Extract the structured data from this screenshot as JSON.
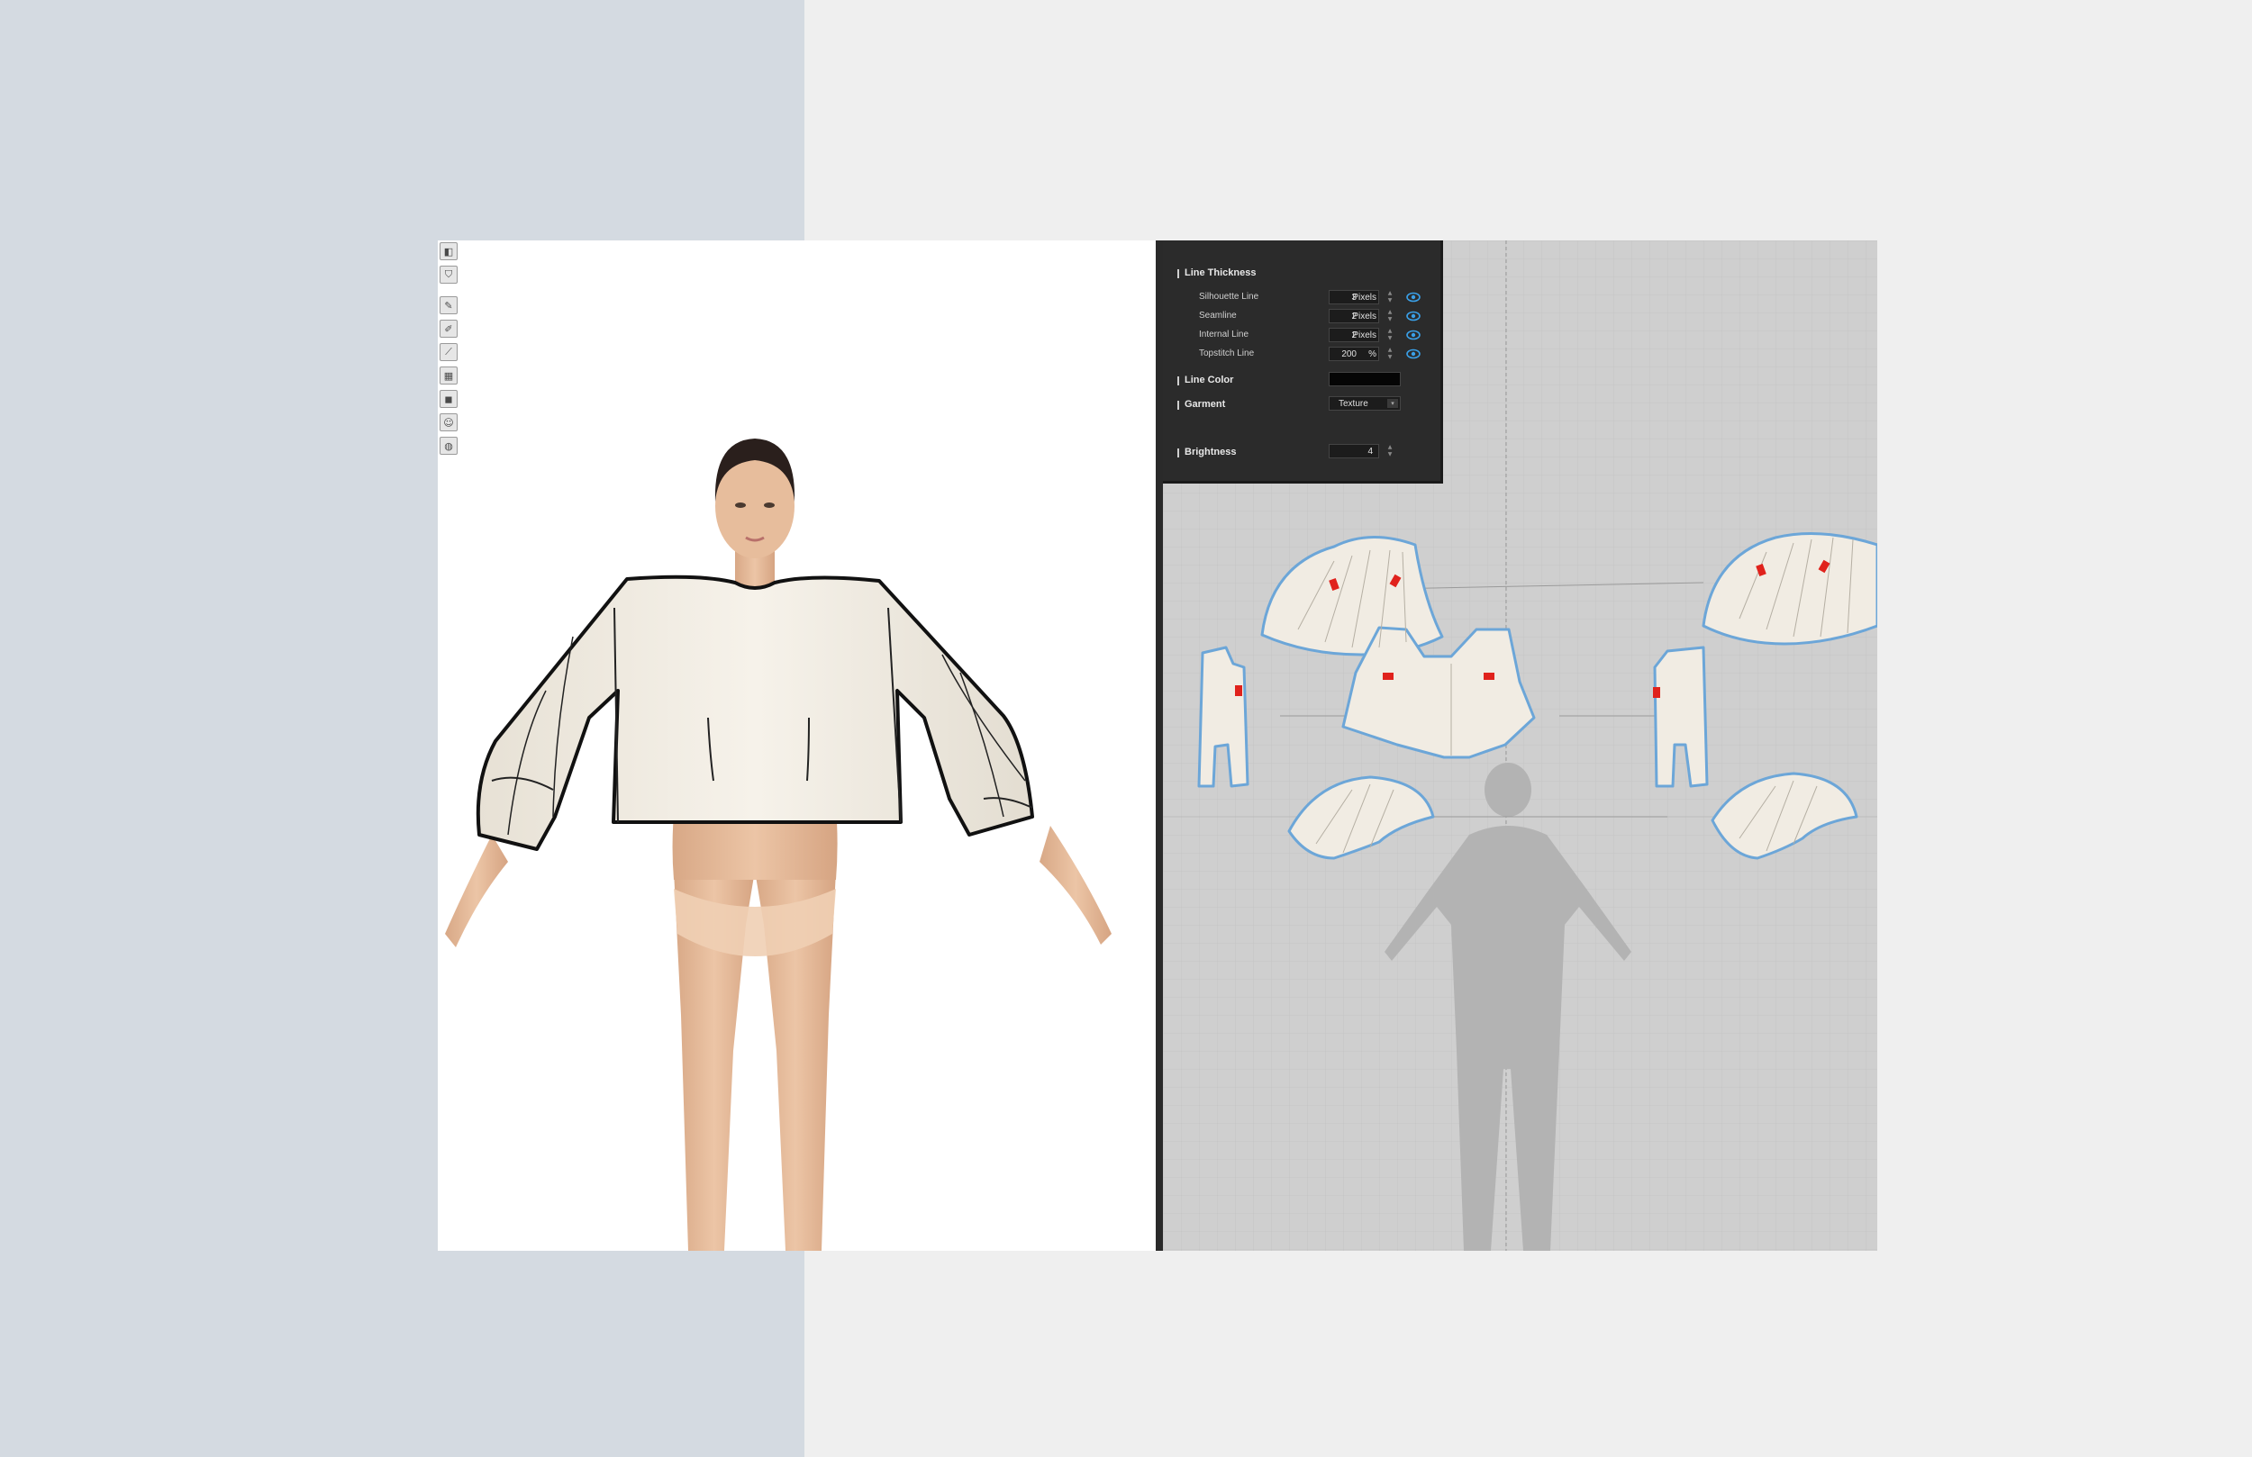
{
  "panel": {
    "line_thickness": {
      "title": "Line Thickness",
      "rows": [
        {
          "label": "Silhouette Line",
          "value": "3",
          "unit": "Pixels"
        },
        {
          "label": "Seamline",
          "value": "2",
          "unit": "Pixels"
        },
        {
          "label": "Internal Line",
          "value": "2",
          "unit": "Pixels"
        },
        {
          "label": "Topstitch Line",
          "value": "200",
          "unit": "%"
        }
      ]
    },
    "line_color": {
      "title": "Line Color",
      "value": "#050505"
    },
    "garment": {
      "title": "Garment",
      "value": "Texture"
    },
    "brightness": {
      "title": "Brightness",
      "value": "4"
    }
  },
  "toolbar": {
    "tools": [
      "camera-icon",
      "garment-icon",
      "brush-icon",
      "pen-icon",
      "ruler-icon",
      "texture-icon",
      "render-icon",
      "avatar-icon",
      "globe-icon"
    ]
  },
  "colors": {
    "accent": "#3aa0e8",
    "fabric": "#f1ece3",
    "panel_bg": "#2b2b2b",
    "viewport_2d_bg": "#cfcfcf"
  }
}
